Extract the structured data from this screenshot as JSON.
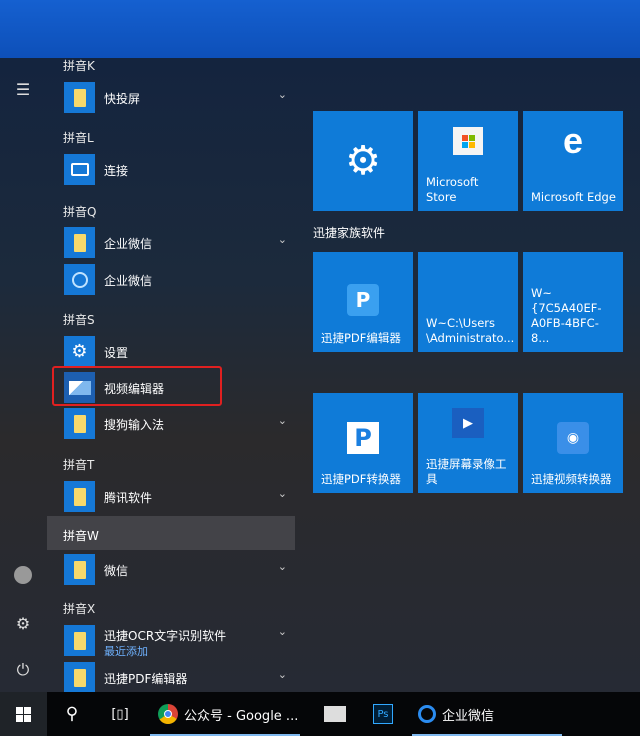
{
  "rail": {
    "menu_icon": "hamburger-icon",
    "user_icon": "user-icon",
    "settings_icon": "gear-icon",
    "power_icon": "power-icon"
  },
  "list": [
    {
      "type": "header",
      "label": "拼音K"
    },
    {
      "type": "app",
      "label": "快投屏",
      "icon": "folder-icon",
      "expand": true
    },
    {
      "type": "header",
      "label": "拼音L"
    },
    {
      "type": "app",
      "label": "连接",
      "icon": "connect-icon"
    },
    {
      "type": "header",
      "label": "拼音Q"
    },
    {
      "type": "app",
      "label": "企业微信",
      "icon": "folder-icon",
      "expand": true
    },
    {
      "type": "app",
      "label": "企业微信",
      "icon": "wecom-icon"
    },
    {
      "type": "header",
      "label": "拼音S"
    },
    {
      "type": "app",
      "label": "设置",
      "icon": "gear-icon"
    },
    {
      "type": "app",
      "label": "视频编辑器",
      "icon": "video-editor-icon"
    },
    {
      "type": "app",
      "label": "搜狗输入法",
      "icon": "folder-icon",
      "expand": true
    },
    {
      "type": "header",
      "label": "拼音T"
    },
    {
      "type": "app",
      "label": "腾讯软件",
      "icon": "folder-icon",
      "expand": true
    },
    {
      "type": "header",
      "label": "拼音W"
    },
    {
      "type": "app",
      "label": "微信",
      "icon": "folder-icon",
      "expand": true
    },
    {
      "type": "header",
      "label": "拼音X"
    },
    {
      "type": "app",
      "label": "迅捷OCR文字识别软件",
      "sub": "最近添加",
      "icon": "folder-icon",
      "expand": true
    },
    {
      "type": "app",
      "label": "迅捷PDF编辑器",
      "icon": "folder-icon",
      "expand": true
    }
  ],
  "tiles": {
    "row1": [
      {
        "label": "",
        "icon": "gear-icon"
      },
      {
        "label": "Microsoft Store",
        "icon": "store-icon"
      },
      {
        "label": "Microsoft Edge",
        "icon": "edge-icon"
      }
    ],
    "group_label": "迅捷家族软件",
    "row2": [
      {
        "label": "迅捷PDF编辑器",
        "icon": "pdf-editor-icon"
      },
      {
        "label": "W~C:\\Users \\Administrato...",
        "icon": ""
      },
      {
        "label": "W~{7C5A40EF-A0FB-4BFC-8...",
        "icon": ""
      }
    ],
    "row3": [
      {
        "label": "迅捷PDF转换器",
        "icon": "pdf-converter-icon"
      },
      {
        "label": "迅捷屏幕录像工具",
        "icon": "screen-recorder-icon"
      },
      {
        "label": "迅捷视频转换器",
        "icon": "video-converter-icon"
      }
    ]
  },
  "taskbar": {
    "chrome_label": "公众号 - Google ...",
    "ps_label": "Ps",
    "wecom_label": "企业微信"
  },
  "colors": {
    "tile": "#0f7bd8",
    "highlight": "#e02020"
  }
}
